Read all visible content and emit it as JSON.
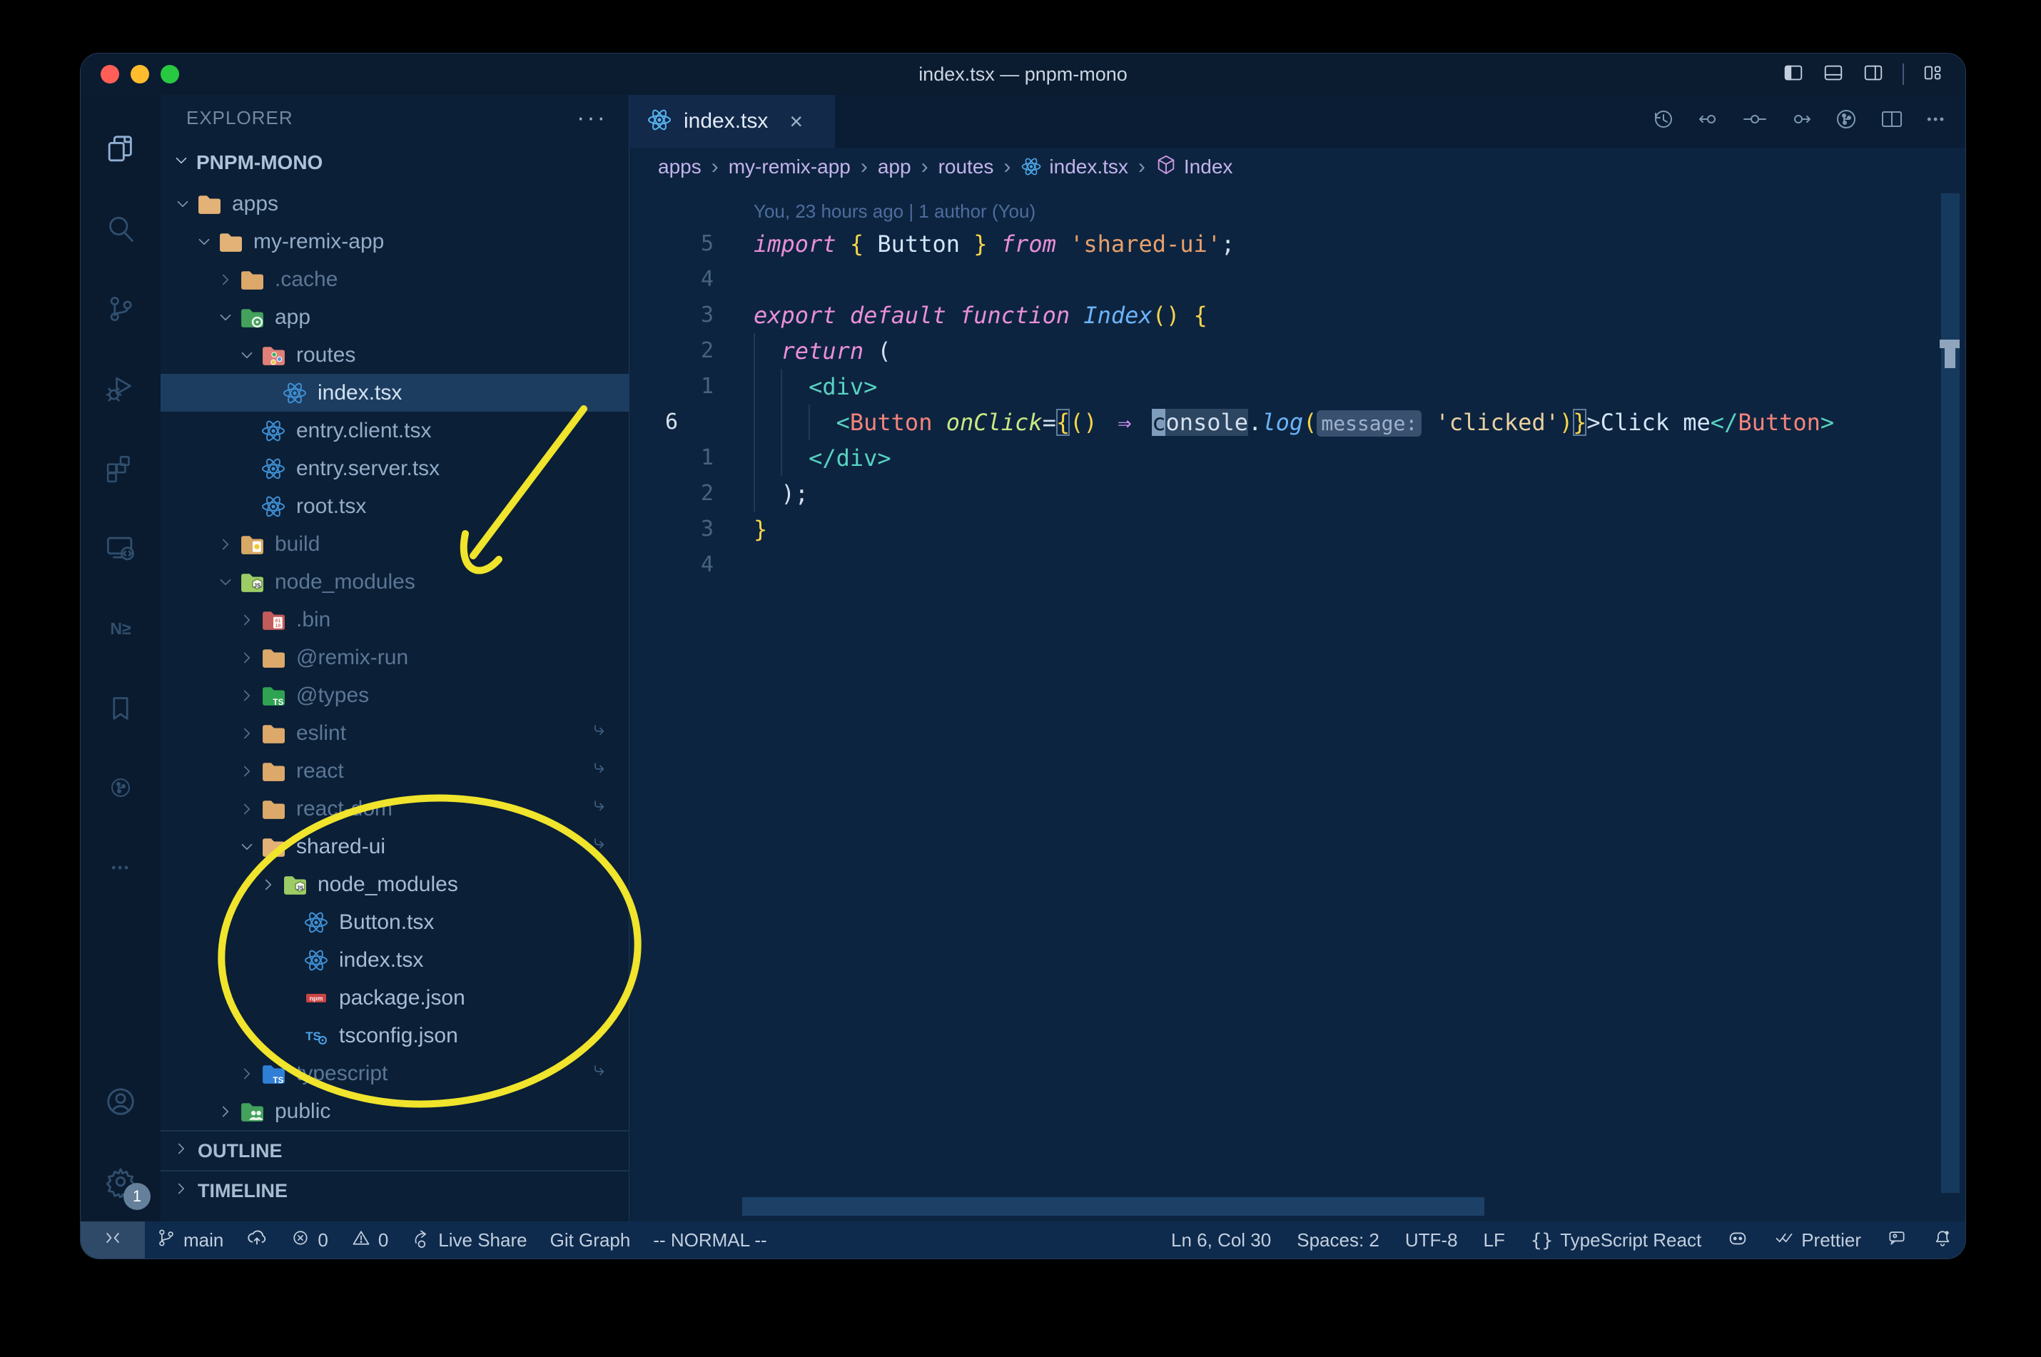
{
  "window": {
    "title": "index.tsx — pnpm-mono"
  },
  "titlebar_controls": [
    "layout-sidebar-left",
    "layout-panel",
    "layout-sidebar-right",
    "separator",
    "layout-customize"
  ],
  "activity_bar": {
    "items": [
      {
        "name": "explorer",
        "active": true
      },
      {
        "name": "search",
        "active": false
      },
      {
        "name": "source-control",
        "active": false
      },
      {
        "name": "run-debug",
        "active": false
      },
      {
        "name": "extensions",
        "active": false
      },
      {
        "name": "remote-explorer",
        "active": false
      },
      {
        "name": "nx-console",
        "active": false
      },
      {
        "name": "bookmarks",
        "active": false
      },
      {
        "name": "gitlens",
        "active": false
      },
      {
        "name": "more",
        "active": false
      }
    ],
    "bottom": [
      {
        "name": "accounts"
      },
      {
        "name": "settings",
        "badge": "1"
      }
    ]
  },
  "explorer": {
    "header": "EXPLORER",
    "header_more": "···",
    "section": "PNPM-MONO",
    "tree": [
      {
        "label": "apps",
        "icon": "folder-tan-open",
        "level": 0,
        "kind": "folder",
        "chevron": "down"
      },
      {
        "label": "my-remix-app",
        "icon": "folder-tan-open",
        "level": 1,
        "kind": "folder",
        "chevron": "down"
      },
      {
        "label": ".cache",
        "icon": "folder-tan",
        "level": 2,
        "kind": "folder",
        "chevron": "right",
        "dim": true
      },
      {
        "label": "app",
        "icon": "folder-app",
        "level": 2,
        "kind": "folder",
        "chevron": "down"
      },
      {
        "label": "routes",
        "icon": "folder-routes",
        "level": 3,
        "kind": "folder",
        "chevron": "down"
      },
      {
        "label": "index.tsx",
        "icon": "react",
        "level": 4,
        "kind": "file",
        "selected": true
      },
      {
        "label": "entry.client.tsx",
        "icon": "react",
        "level": 3,
        "kind": "file"
      },
      {
        "label": "entry.server.tsx",
        "icon": "react",
        "level": 3,
        "kind": "file"
      },
      {
        "label": "root.tsx",
        "icon": "react",
        "level": 3,
        "kind": "file"
      },
      {
        "label": "build",
        "icon": "folder-dist",
        "level": 2,
        "kind": "folder",
        "chevron": "right",
        "dim": true
      },
      {
        "label": "node_modules",
        "icon": "folder-node",
        "level": 2,
        "kind": "folder",
        "chevron": "down",
        "dim": true
      },
      {
        "label": ".bin",
        "icon": "folder-bin",
        "level": 3,
        "kind": "folder",
        "chevron": "right",
        "dim": true
      },
      {
        "label": "@remix-run",
        "icon": "folder-tan",
        "level": 3,
        "kind": "folder",
        "chevron": "right",
        "dim": true
      },
      {
        "label": "@types",
        "icon": "folder-types",
        "level": 3,
        "kind": "folder",
        "chevron": "right",
        "dim": true
      },
      {
        "label": "eslint",
        "icon": "folder-tan",
        "level": 3,
        "kind": "folder",
        "chevron": "right",
        "dim": true,
        "symlink": true
      },
      {
        "label": "react",
        "icon": "folder-tan",
        "level": 3,
        "kind": "folder",
        "chevron": "right",
        "dim": true,
        "symlink": true
      },
      {
        "label": "react-dom",
        "icon": "folder-tan",
        "level": 3,
        "kind": "folder",
        "chevron": "right",
        "dim": true,
        "symlink": true
      },
      {
        "label": "shared-ui",
        "icon": "folder-tan-open",
        "level": 3,
        "kind": "folder",
        "chevron": "down",
        "bright": true,
        "symlink": true
      },
      {
        "label": "node_modules",
        "icon": "folder-node",
        "level": 4,
        "kind": "folder",
        "chevron": "right",
        "bright": true
      },
      {
        "label": "Button.tsx",
        "icon": "react",
        "level": 5,
        "kind": "file",
        "bright": true
      },
      {
        "label": "index.tsx",
        "icon": "react",
        "level": 5,
        "kind": "file",
        "bright": true
      },
      {
        "label": "package.json",
        "icon": "npm",
        "level": 5,
        "kind": "file",
        "bright": true
      },
      {
        "label": "tsconfig.json",
        "icon": "tsconfig",
        "level": 5,
        "kind": "file",
        "bright": true
      },
      {
        "label": "typescript",
        "icon": "folder-ts",
        "level": 3,
        "kind": "folder",
        "chevron": "right",
        "dim": true,
        "symlink": true
      },
      {
        "label": "public",
        "icon": "folder-public",
        "level": 2,
        "kind": "folder",
        "chevron": "right"
      }
    ],
    "sections": [
      "OUTLINE",
      "TIMELINE"
    ]
  },
  "editor": {
    "tab": {
      "label": "index.tsx",
      "icon": "react",
      "close": "×"
    },
    "actions": [
      "history",
      "prev-change",
      "change",
      "next-change",
      "gitlens",
      "split-editor",
      "more"
    ],
    "breadcrumbs": [
      {
        "label": "apps"
      },
      {
        "label": "my-remix-app"
      },
      {
        "label": "app"
      },
      {
        "label": "routes"
      },
      {
        "label": "index.tsx",
        "icon": "react"
      },
      {
        "label": "Index",
        "icon": "cube"
      }
    ],
    "blame": "You, 23 hours ago | 1 author (You)",
    "lines": [
      {
        "num": "5",
        "guides": [],
        "tokens": [
          {
            "t": "import",
            "s": "kw"
          },
          {
            "t": " ",
            "s": "op"
          },
          {
            "t": "{",
            "s": "gold"
          },
          {
            "t": " Button ",
            "s": "id"
          },
          {
            "t": "}",
            "s": "gold"
          },
          {
            "t": " ",
            "s": "op"
          },
          {
            "t": "from",
            "s": "kw"
          },
          {
            "t": " ",
            "s": "op"
          },
          {
            "t": "'shared-ui'",
            "s": "str"
          },
          {
            "t": ";",
            "s": "op"
          }
        ]
      },
      {
        "num": "4",
        "guides": [],
        "tokens": []
      },
      {
        "num": "3",
        "guides": [],
        "tokens": [
          {
            "t": "export",
            "s": "kw"
          },
          {
            "t": " ",
            "s": "op"
          },
          {
            "t": "default",
            "s": "kw"
          },
          {
            "t": " ",
            "s": "op"
          },
          {
            "t": "function",
            "s": "kw"
          },
          {
            "t": " ",
            "s": "op"
          },
          {
            "t": "Index",
            "s": "fn"
          },
          {
            "t": "()",
            "s": "gold"
          },
          {
            "t": " ",
            "s": "op"
          },
          {
            "t": "{",
            "s": "gold"
          }
        ]
      },
      {
        "num": "2",
        "guides": [
          0
        ],
        "tokens": [
          {
            "t": "  ",
            "s": "op"
          },
          {
            "t": "return",
            "s": "kw"
          },
          {
            "t": " (",
            "s": "op"
          }
        ]
      },
      {
        "num": "1",
        "guides": [
          0,
          2
        ],
        "tokens": [
          {
            "t": "    ",
            "s": "op"
          },
          {
            "t": "<div>",
            "s": "tag"
          }
        ]
      },
      {
        "num": "6",
        "current": true,
        "guides": [
          0,
          2,
          4
        ],
        "tokens": [
          {
            "t": "      ",
            "s": "op"
          },
          {
            "t": "<",
            "s": "tag"
          },
          {
            "t": "Button",
            "s": "comp"
          },
          {
            "t": " ",
            "s": "op"
          },
          {
            "t": "onClick",
            "s": "attr"
          },
          {
            "t": "=",
            "s": "op"
          },
          {
            "t": "{",
            "s": "goldbox"
          },
          {
            "t": "()",
            "s": "gold"
          },
          {
            "t": " ",
            "s": "op"
          },
          {
            "t": "⇒",
            "s": "arrow"
          },
          {
            "t": " ",
            "s": "op"
          },
          {
            "t": "c",
            "s": "cursor"
          },
          {
            "t": "onsole",
            "s": "hl"
          },
          {
            "t": ".",
            "s": "op"
          },
          {
            "t": "log",
            "s": "fn"
          },
          {
            "t": "(",
            "s": "gold"
          },
          {
            "t": "message:",
            "s": "inlay"
          },
          {
            "t": " ",
            "s": "op"
          },
          {
            "t": "'clicked'",
            "s": "str2"
          },
          {
            "t": ")",
            "s": "gold"
          },
          {
            "t": "}",
            "s": "goldbox"
          },
          {
            "t": ">",
            "s": "op"
          },
          {
            "t": "Click me",
            "s": "id"
          },
          {
            "t": "</",
            "s": "tag"
          },
          {
            "t": "Button",
            "s": "comp"
          },
          {
            "t": ">",
            "s": "tag"
          }
        ]
      },
      {
        "num": "1",
        "guides": [
          0,
          2
        ],
        "tokens": [
          {
            "t": "    ",
            "s": "op"
          },
          {
            "t": "</div>",
            "s": "tag"
          }
        ]
      },
      {
        "num": "2",
        "guides": [
          0
        ],
        "tokens": [
          {
            "t": "  ",
            "s": "op"
          },
          {
            "t": ");",
            "s": "op"
          }
        ]
      },
      {
        "num": "3",
        "guides": [],
        "tokens": [
          {
            "t": "}",
            "s": "gold"
          }
        ]
      },
      {
        "num": "4",
        "guides": [],
        "tokens": []
      }
    ]
  },
  "status_bar": {
    "left": [
      {
        "icon": "remote",
        "style": "remote"
      },
      {
        "icon": "branch",
        "label": "main"
      },
      {
        "icon": "cloud-upload"
      },
      {
        "icon": "error",
        "label": "0"
      },
      {
        "icon": "warning",
        "label": "0"
      },
      {
        "icon": "live-share",
        "label": "Live Share"
      },
      {
        "label": "Git Graph"
      },
      {
        "label": "-- NORMAL --"
      }
    ],
    "right": [
      {
        "label": "Ln 6, Col 30"
      },
      {
        "label": "Spaces: 2"
      },
      {
        "label": "UTF-8"
      },
      {
        "label": "LF"
      },
      {
        "icon": "braces",
        "label": "TypeScript React"
      },
      {
        "icon": "copilot"
      },
      {
        "icon": "double-check",
        "label": "Prettier"
      },
      {
        "icon": "feedback"
      },
      {
        "icon": "bell"
      }
    ]
  },
  "colors": {
    "traffic_red": "#ff5f57",
    "traffic_yellow": "#febc2e",
    "traffic_green": "#28c840",
    "annotation_yellow": "#f0e42c",
    "react_blue": "#3f8fd4",
    "folder_tan": "#dca96b",
    "selection_row": "#1d3d60",
    "editor_bg": "#0d2440"
  }
}
